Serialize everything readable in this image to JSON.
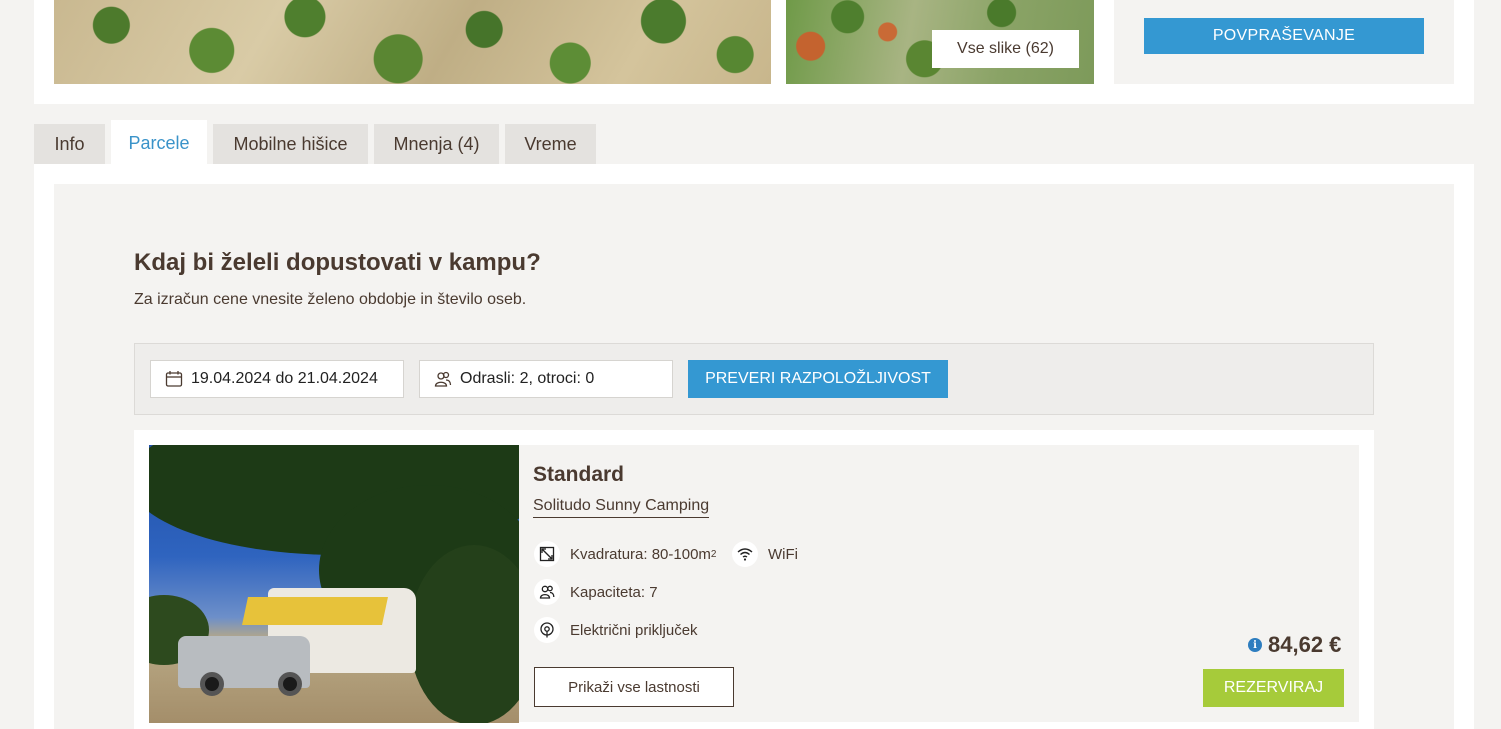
{
  "gallery": {
    "all_photos_label": "Vse slike (62)",
    "inquiry_label": "POVPRAŠEVANJE"
  },
  "tabs": [
    {
      "label": "Info",
      "active": false
    },
    {
      "label": "Parcele",
      "active": true
    },
    {
      "label": "Mobilne hišice",
      "active": false
    },
    {
      "label": "Mnenja (4)",
      "active": false
    },
    {
      "label": "Vreme",
      "active": false
    }
  ],
  "booking": {
    "heading": "Kdaj bi želeli dopustovati v kampu?",
    "subheading": "Za izračun cene vnesite želeno obdobje in število oseb.",
    "dates_value": "19.04.2024 do 21.04.2024",
    "guests_value": "Odrasli: 2, otroci: 0",
    "check_label": "PREVERI RAZPOLOŽLJIVOST"
  },
  "pitch": {
    "title": "Standard",
    "camp_name": "Solitudo Sunny Camping",
    "size_label": "Kvadratura: 80-100m",
    "size_sup": "2",
    "wifi_label": "WiFi",
    "capacity_label": "Kapaciteta: 7",
    "electric_label": "Električni priključek",
    "props_label": "Prikaži vse lastnosti",
    "price": "84,62 €",
    "info_symbol": "i",
    "reserve_label": "REZERVIRAJ"
  },
  "colors": {
    "accent_blue": "#3498d2",
    "reserve_green": "#a6cb3a",
    "text_brown": "#4a3a30",
    "active_tab": "#3a93c9"
  },
  "icons": [
    "calendar-icon",
    "users-icon",
    "area-icon",
    "wifi-icon",
    "capacity-icon",
    "plug-icon",
    "info-icon"
  ]
}
